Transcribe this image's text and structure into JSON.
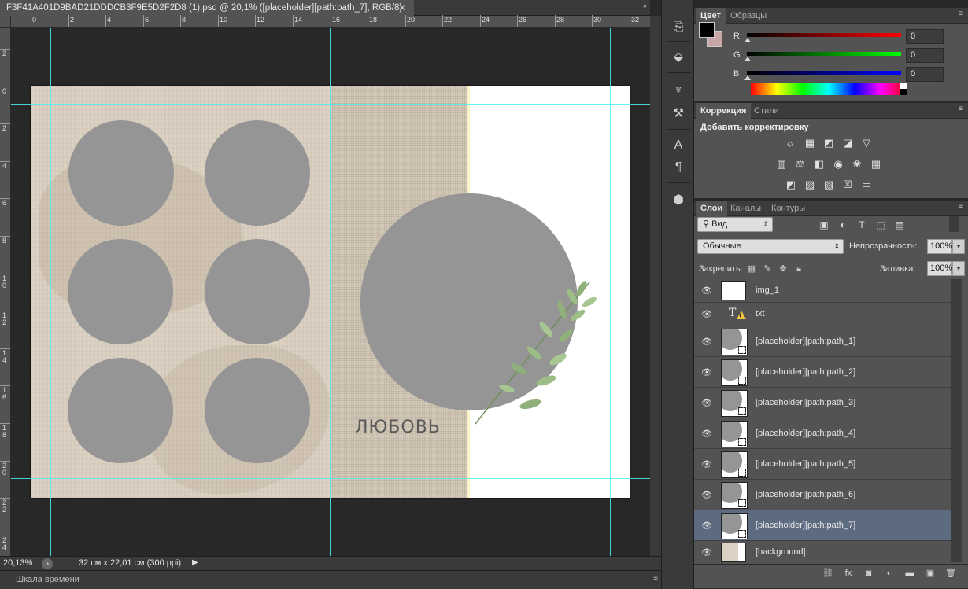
{
  "document": {
    "tab_title": "F3F41A401D9BAD21DDDCB3F9E5D2F2D8 (1).psd @ 20,1% ([placeholder][path:path_7], RGB/8)",
    "close_glyph": "✕",
    "canvas_text": "ЛЮБОВЬ"
  },
  "rulers": {
    "horizontal": [
      "0",
      "2",
      "4",
      "6",
      "8",
      "10",
      "12",
      "14",
      "16",
      "18",
      "20",
      "22",
      "24",
      "26",
      "28",
      "30",
      "32"
    ],
    "vertical": [
      "2",
      "0",
      "2",
      "4",
      "6",
      "8",
      "1 0",
      "1 2",
      "1 4",
      "1 6",
      "1 8",
      "2 0",
      "2 2",
      "2 4"
    ]
  },
  "status": {
    "zoom": "20,13%",
    "doc_size": "32 см x 22,01 см (300 ppi)"
  },
  "timeline": {
    "label": "Шкала времени"
  },
  "color_panel": {
    "tabs": [
      "Цвет",
      "Образцы"
    ],
    "foreground": "#000000",
    "background": "#c8a6a6",
    "channels": [
      {
        "name": "R",
        "value": "0",
        "gradient": [
          "#000000",
          "#ff0000"
        ]
      },
      {
        "name": "G",
        "value": "0",
        "gradient": [
          "#000000",
          "#00ff00"
        ]
      },
      {
        "name": "B",
        "value": "0",
        "gradient": [
          "#000000",
          "#0000ff"
        ]
      }
    ]
  },
  "adjustments_panel": {
    "tabs": [
      "Коррекция",
      "Стили"
    ],
    "title": "Добавить корректировку"
  },
  "layers_panel": {
    "tabs": [
      "Слои",
      "Каналы",
      "Контуры"
    ],
    "filter_kind": "Вид",
    "blend_mode": "Обычные",
    "opacity_label": "Непрозрачность:",
    "opacity": "100%",
    "lock_label": "Закрепить:",
    "fill_label": "Заливка:",
    "fill": "100%",
    "layers": [
      {
        "name": "img_1",
        "kind": "transparent"
      },
      {
        "name": "txt",
        "kind": "text"
      },
      {
        "name": "[placeholder][path:path_1]",
        "kind": "shape"
      },
      {
        "name": "[placeholder][path:path_2]",
        "kind": "shape"
      },
      {
        "name": "[placeholder][path:path_3]",
        "kind": "shape"
      },
      {
        "name": "[placeholder][path:path_4]",
        "kind": "shape"
      },
      {
        "name": "[placeholder][path:path_5]",
        "kind": "shape"
      },
      {
        "name": "[placeholder][path:path_6]",
        "kind": "shape"
      },
      {
        "name": "[placeholder][path:path_7]",
        "kind": "shape",
        "selected": true
      },
      {
        "name": "[background]",
        "kind": "image"
      }
    ]
  },
  "colors": {
    "guide": "#4ff0f0",
    "placeholder": "#959595",
    "selected_layer": "#5d6b80"
  }
}
